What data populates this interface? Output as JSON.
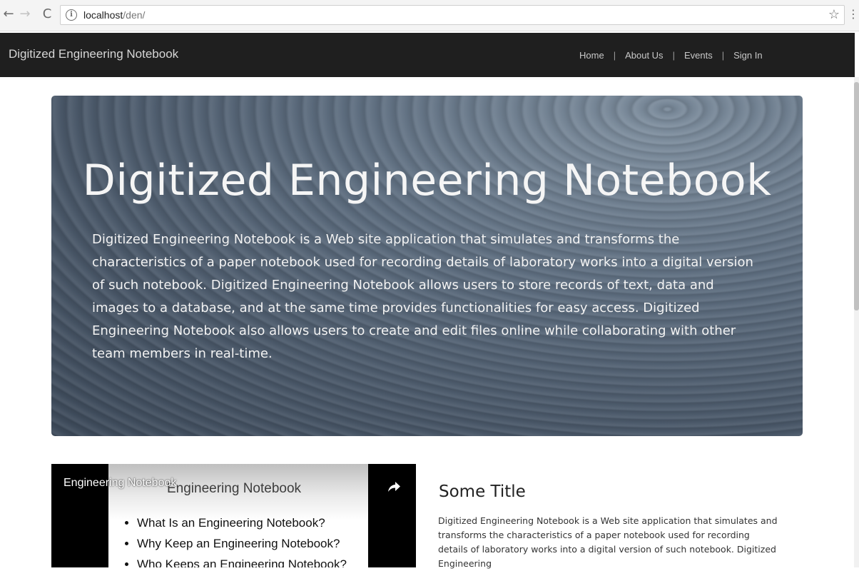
{
  "browser": {
    "back_icon": "←",
    "forward_icon": "→",
    "reload_icon": "C",
    "info_icon": "i",
    "url_host": "localhost",
    "url_path": "/den/",
    "bookmark_icon": "☆",
    "menu_icon": "⋮"
  },
  "navbar": {
    "brand": "Digitized Engineering Notebook",
    "items": [
      {
        "label": "Home"
      },
      {
        "label": "About Us"
      },
      {
        "label": "Events"
      },
      {
        "label": "Sign In"
      }
    ],
    "separator": "|"
  },
  "hero": {
    "title": "Digitized Engineering Notebook",
    "text": "Digitized Engineering Notebook is a Web site application that simulates and transforms the characteristics of a paper notebook used for recording details of laboratory works into a digital version of such notebook. Digitized Engineering Notebook allows users to store records of text, data and images to a database, and at the same time provides functionalities for easy access. Digitized Engineering Notebook also allows users to create and edit files online while collaborating with other team members in real-time."
  },
  "video": {
    "title": "Engineering Notebook",
    "slide_title": "Engineering Notebook",
    "slide_items": [
      "What Is an Engineering Notebook?",
      "Why Keep an Engineering Notebook?",
      "Who Keeps an Engineering Notebook?"
    ]
  },
  "side": {
    "title": "Some Title",
    "text": "Digitized Engineering Notebook is a Web site application that simulates and transforms the characteristics of a paper notebook used for recording details of laboratory works into a digital version of such notebook. Digitized Engineering"
  }
}
